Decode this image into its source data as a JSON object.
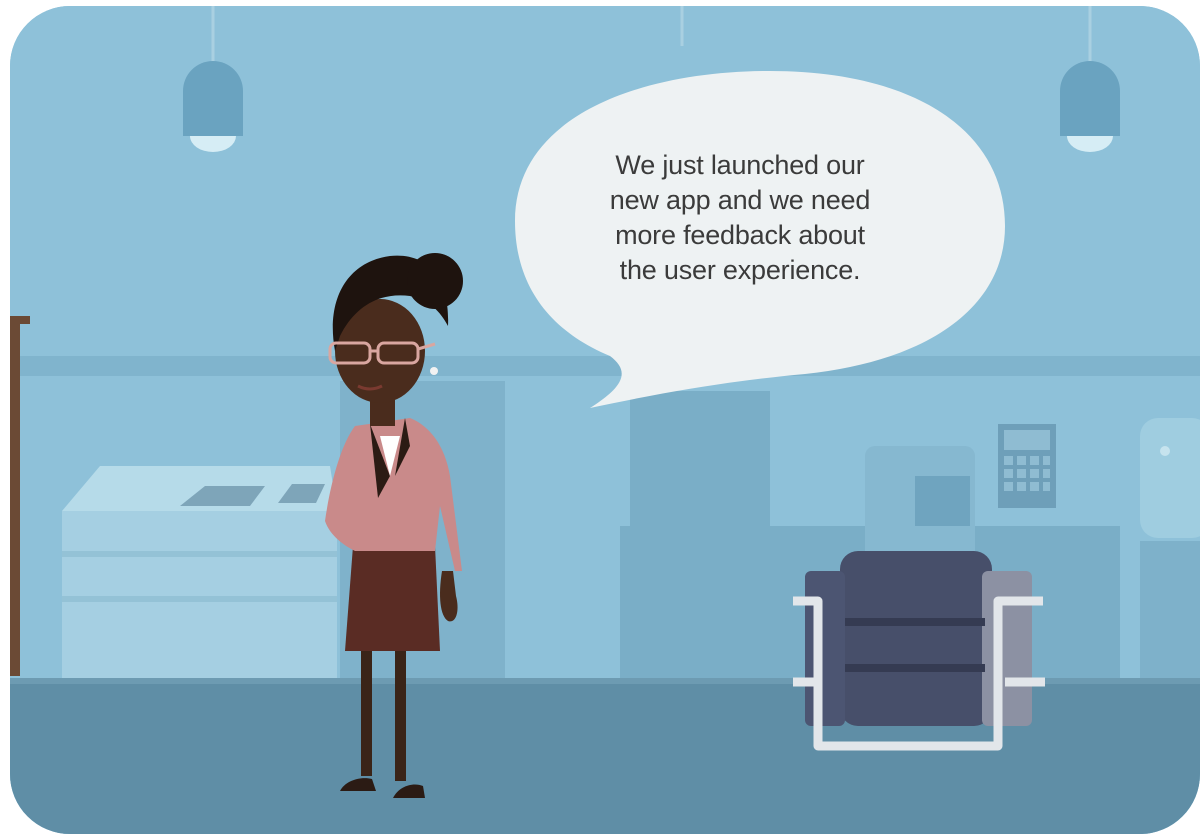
{
  "scene": {
    "colors": {
      "wall": "#8ec1d9",
      "wall_dark": "#7aafc9",
      "floor": "#5f8ea6",
      "bubble": "#eef2f3",
      "jacket": "#c98a8a",
      "skirt": "#5a2c24",
      "chair": "#4c5572"
    },
    "speech_bubble": {
      "lines": [
        "We just launched our",
        "new app and we need",
        "more feedback about",
        "the user experience."
      ]
    }
  }
}
